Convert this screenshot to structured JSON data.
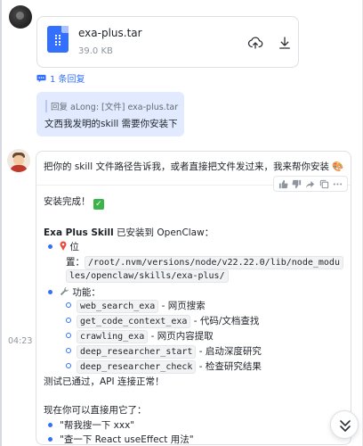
{
  "file_message": {
    "file_name": "exa-plus.tar",
    "file_size": "39.0 KB",
    "reply_count": "1 条回复"
  },
  "quote": {
    "header": "回复 aLong: [文件] exa-plus.tar",
    "text": "文西我发明的skill 需要你安装下"
  },
  "bot": {
    "intro": "把你的 skill 文件路径告诉我，或者直接把文件发过来，我来帮你安装 🎨",
    "done": "安装完成！",
    "installed_line_bold": "Exa Plus Skill",
    "installed_line_rest": " 已安装到 OpenClaw：",
    "location_label": "位",
    "location_prefix": "置：",
    "path_part1": "/root/.nvm/versions/node/v22.22.0/lib/node_modu",
    "path_part2": "les/openclaw/skills/exa-plus/",
    "features_label": "功能：",
    "features": [
      {
        "code": "web_search_exa",
        "desc": " - 网页搜索"
      },
      {
        "code": "get_code_context_exa",
        "desc": " - 代码/文档查找"
      },
      {
        "code": "crawling_exa",
        "desc": " - 网页内容提取"
      },
      {
        "code": "deep_researcher_start",
        "desc": " - 启动深度研究"
      },
      {
        "code": "deep_researcher_check",
        "desc": " - 检查研究结果"
      }
    ],
    "test_line": "测试已通过，API 连接正常！",
    "usage_intro": "现在你可以直接用它了：",
    "examples": [
      "\"帮我搜一下 xxx\"",
      "\"查一下 React useEffect 用法\""
    ],
    "timestamp": "04:23"
  },
  "colors": {
    "accent": "#3370ff",
    "quote_bg": "#e1eaff",
    "check_green": "#3bb44a"
  },
  "icons": [
    "file-archive-icon",
    "share-icon",
    "download-icon",
    "reply-icon",
    "thumbs-up-icon",
    "thumbs-down-icon",
    "forward-icon",
    "copy-icon",
    "more-icon",
    "pin-icon",
    "wrench-icon",
    "check-icon",
    "chevron-double-down-icon"
  ]
}
